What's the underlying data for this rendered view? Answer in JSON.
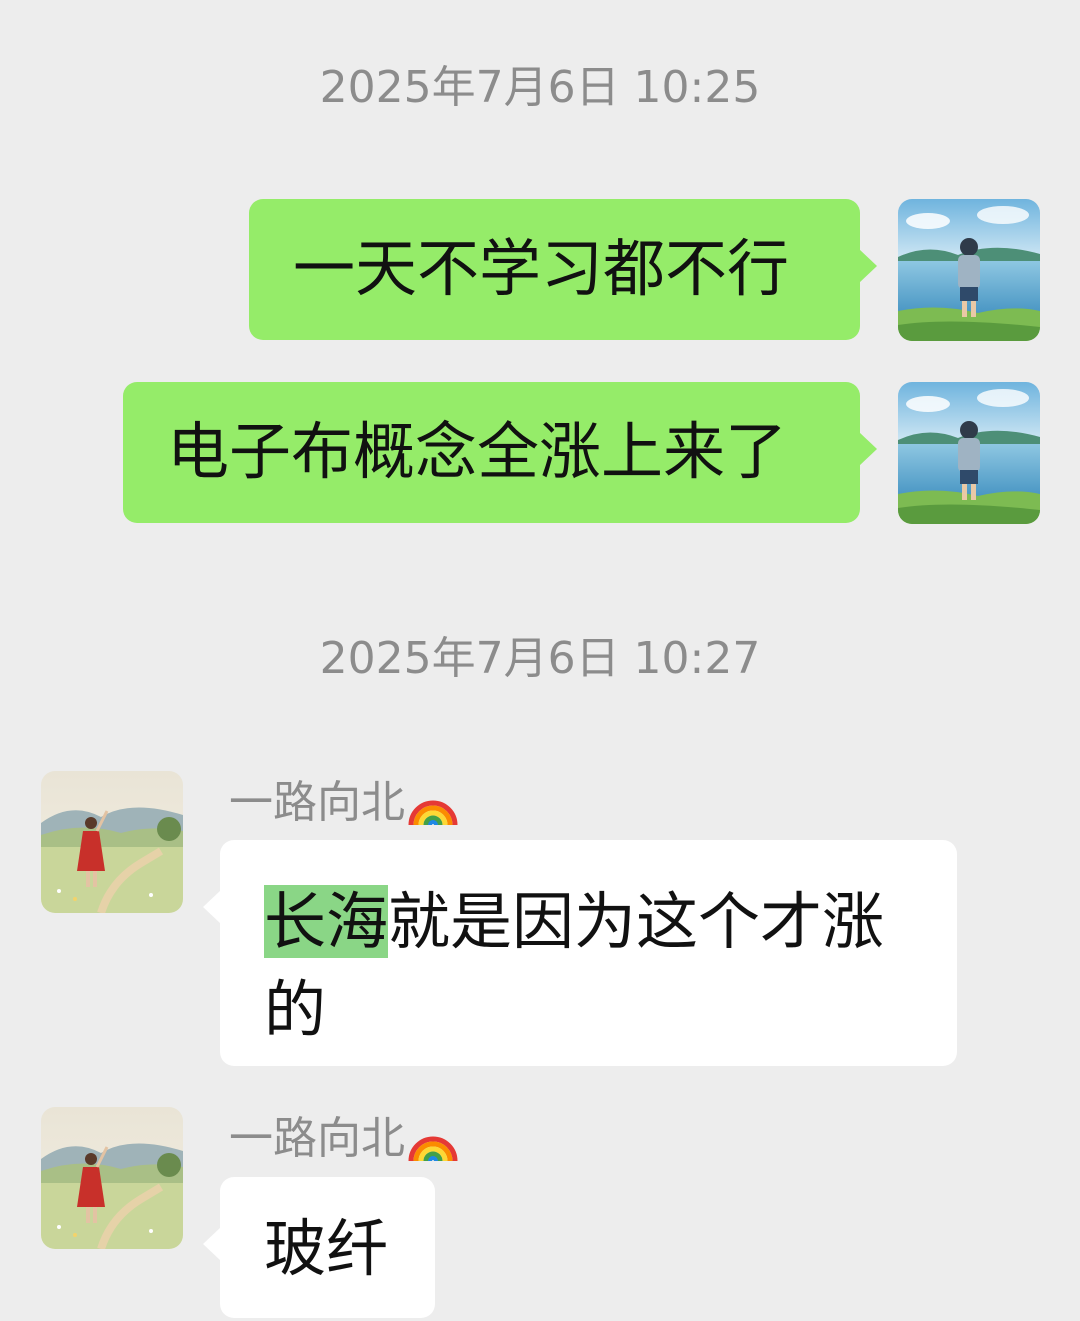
{
  "timestamps": [
    "2025年7月6日 10:25",
    "2025年7月6日 10:27"
  ],
  "messages": {
    "m1": {
      "text": "一天不学习都不行"
    },
    "m2": {
      "text": "电子布概念全涨上来了"
    },
    "m3": {
      "sender": "一路向北",
      "highlight": "长海",
      "rest_line1": "就是因为这个才涨",
      "rest_line2": "的"
    },
    "m4": {
      "sender": "一路向北",
      "text": "玻纤"
    }
  },
  "icons": {
    "sender_emoji": "rainbow-icon",
    "self_avatar": "boy-by-lake-avatar",
    "other_avatar": "girl-in-red-dress-avatar"
  },
  "colors": {
    "background": "#ededed",
    "outgoing_bubble": "#95ec69",
    "incoming_bubble": "#ffffff",
    "timestamp_text": "#8c8c8c",
    "highlight": "#8ad686"
  }
}
